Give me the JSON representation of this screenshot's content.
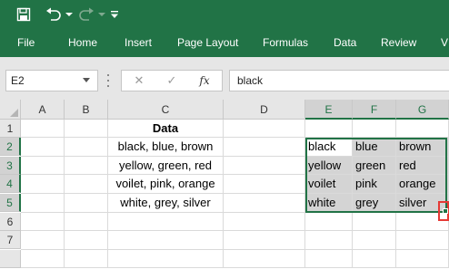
{
  "quick_access": {
    "save_icon": "save-icon",
    "undo_icon": "undo-icon",
    "redo_icon": "redo-icon",
    "customize_icon": "customize-dropdown-icon"
  },
  "ribbon": {
    "tabs": [
      {
        "label": "File"
      },
      {
        "label": "Home"
      },
      {
        "label": "Insert"
      },
      {
        "label": "Page Layout"
      },
      {
        "label": "Formulas"
      },
      {
        "label": "Data"
      },
      {
        "label": "Review"
      },
      {
        "label": "V"
      }
    ]
  },
  "formula_bar": {
    "name_box": "E2",
    "cancel_symbol": "✕",
    "enter_symbol": "✓",
    "fx_label": "fx",
    "value": "black"
  },
  "grid": {
    "columns": [
      "A",
      "B",
      "C",
      "D",
      "E",
      "F",
      "G"
    ],
    "rows": [
      "1",
      "2",
      "3",
      "4",
      "5",
      "6",
      "7"
    ],
    "c1": "Data",
    "c2": "black, blue, brown",
    "c3": "yellow, green, red",
    "c4": "voilet, pink, orange",
    "c5": "white, grey, silver",
    "split": [
      [
        "black",
        "blue",
        "brown"
      ],
      [
        "yellow",
        "green",
        "red"
      ],
      [
        "voilet",
        "pink",
        "orange"
      ],
      [
        "white",
        "grey",
        "silver"
      ]
    ]
  },
  "colors": {
    "excel_green": "#217346",
    "highlight_red": "#e53935"
  }
}
